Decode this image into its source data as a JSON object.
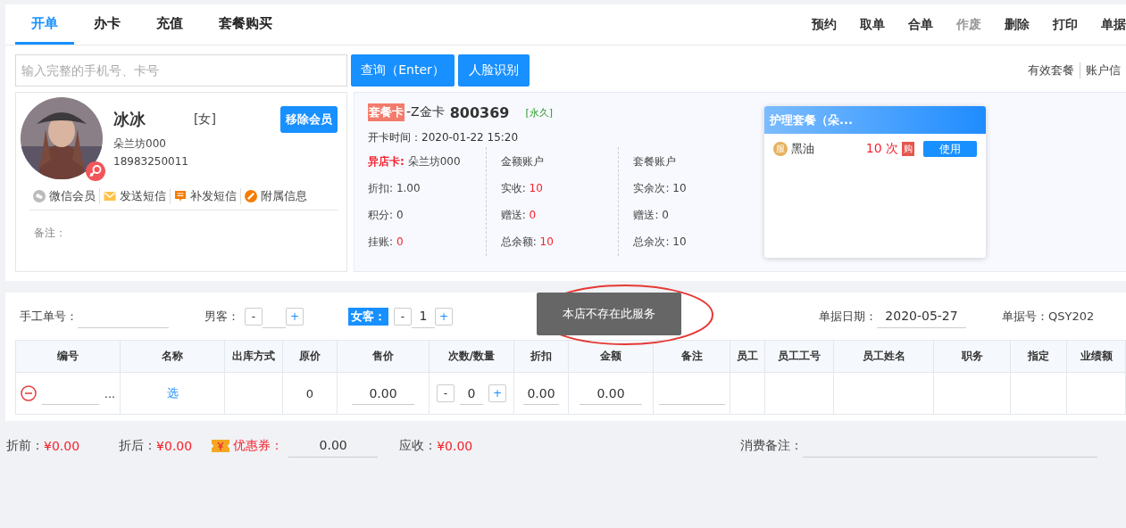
{
  "tabs": [
    {
      "label": "开单",
      "selected": true
    },
    {
      "label": "办卡",
      "selected": false
    },
    {
      "label": "充值",
      "selected": false
    },
    {
      "label": "套餐购买",
      "selected": false
    }
  ],
  "actions": [
    {
      "label": "预约",
      "disabled": false
    },
    {
      "label": "取单",
      "disabled": false
    },
    {
      "label": "合单",
      "disabled": false
    },
    {
      "label": "作废",
      "disabled": true
    },
    {
      "label": "删除",
      "disabled": false
    },
    {
      "label": "打印",
      "disabled": false
    },
    {
      "label": "单据",
      "disabled": false
    }
  ],
  "search": {
    "placeholder": "输入完整的手机号、卡号",
    "query_button": "查询（Enter）",
    "face_button": "人脸识别"
  },
  "right_links": [
    "有效套餐",
    "账户信"
  ],
  "member": {
    "name": "冰冰",
    "gender": "[女]",
    "store": "朵兰坊000",
    "phone": "18983250011",
    "remove_button": "移除会员",
    "links": [
      {
        "kind": "wechat",
        "label": "微信会员"
      },
      {
        "kind": "mail",
        "label": "发送短信"
      },
      {
        "kind": "message",
        "label": "补发短信"
      },
      {
        "kind": "link",
        "label": "附属信息"
      }
    ],
    "note_label": "备注："
  },
  "card": {
    "type": "套餐卡",
    "name": "-Z金卡",
    "number": "800369",
    "validity": "[永久]",
    "open_time": "开卡时间：2020-01-22 15:20",
    "columns": [
      {
        "rows": [
          {
            "label": "异店卡:",
            "value": "朵兰坊000",
            "label_red": true,
            "value_red": false
          },
          {
            "label": "折扣:",
            "value": "1.00",
            "label_red": false,
            "value_red": false
          },
          {
            "label": "积分:",
            "value": "0",
            "label_red": false,
            "value_red": false
          },
          {
            "label": "挂账:",
            "value": "0",
            "label_red": false,
            "value_red": true
          }
        ]
      },
      {
        "rows": [
          {
            "label": "金额账户",
            "label_red": false
          },
          {
            "label": "实收:",
            "value": "10",
            "label_red": false,
            "value_red": true
          },
          {
            "label": "赠送:",
            "value": "0",
            "label_red": false,
            "value_red": true
          },
          {
            "label": "总余额:",
            "value": "10",
            "label_red": false,
            "value_red": true
          }
        ]
      },
      {
        "rows": [
          {
            "label": "套餐账户",
            "label_red": false
          },
          {
            "label": "实余次:",
            "value": "10",
            "label_red": false,
            "value_red": false
          },
          {
            "label": "赠送:",
            "value": "0",
            "label_red": false,
            "value_red": false
          },
          {
            "label": "总余次:",
            "value": "10",
            "label_red": false,
            "value_red": false
          }
        ]
      }
    ]
  },
  "package_panel": {
    "title": "护理套餐（朵...",
    "items": [
      {
        "badge": "服",
        "name": "黑油",
        "count": "10 次",
        "tag": "购",
        "button": "使用"
      }
    ]
  },
  "order": {
    "manual_label": "手工单号：",
    "male": {
      "label": "男客：",
      "minus": "-",
      "plus": "+",
      "highlighted": false
    },
    "female": {
      "label": "女客：",
      "value": "1",
      "minus": "-",
      "plus": "+",
      "highlighted": true
    },
    "date_label": "单据日期：",
    "date": "2020-05-27",
    "number_label": "单据号：QSY202"
  },
  "toast": "本店不存在此服务",
  "table": {
    "columns": [
      "编号",
      "名称",
      "出库方式",
      "原价",
      "售价",
      "次数/数量",
      "折扣",
      "金额",
      "备注",
      "员工",
      "员工工号",
      "员工姓名",
      "职务",
      "指定",
      "业绩额"
    ],
    "rows": [
      {
        "more": "...",
        "name_link": "选",
        "original_price": "0",
        "price": "0.00",
        "quantity": "0",
        "minus": "-",
        "plus": "+",
        "discount": "0.00",
        "amount": "0.00"
      }
    ]
  },
  "footer": {
    "before_label": "折前：",
    "before": "¥0.00",
    "after_label": "折后：",
    "after": "¥0.00",
    "coupon_label": "优惠券：",
    "coupon": "0.00",
    "receivable_label": "应收：",
    "receivable": "¥0.00",
    "remark_label": "消费备注："
  }
}
